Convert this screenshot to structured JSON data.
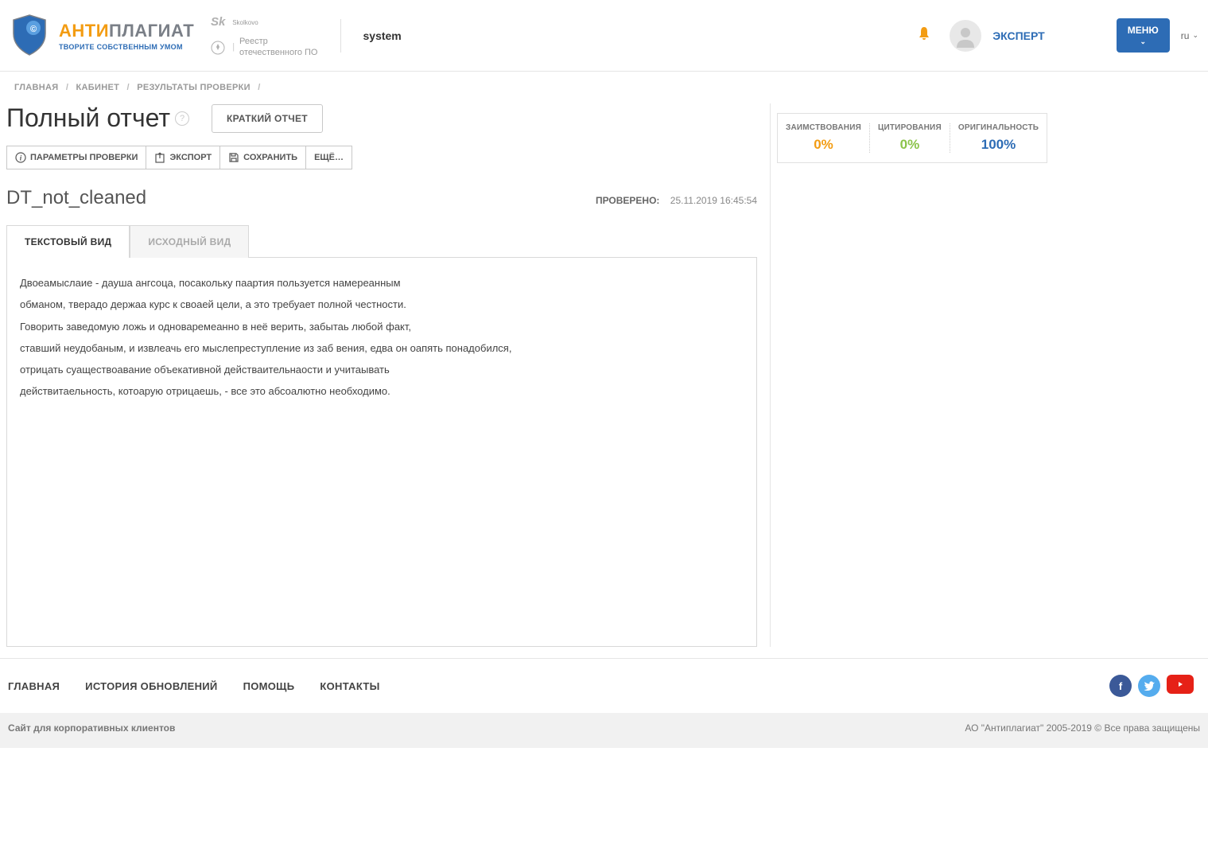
{
  "header": {
    "logo_prefix": "АНТИ",
    "logo_suffix": "ПЛАГИАТ",
    "logo_subtitle": "ТВОРИТЕ СОБСТВЕННЫМ УМОМ",
    "partner_sk": "Skolkovo",
    "partner_registry_l1": "Реестр",
    "partner_registry_l2": "отечественного ПО",
    "system_label": "system",
    "role_label": "ЭКСПЕРТ",
    "menu_label": "МЕНЮ",
    "lang": "ru"
  },
  "breadcrumb": {
    "items": [
      "ГЛАВНАЯ",
      "КАБИНЕТ",
      "РЕЗУЛЬТАТЫ ПРОВЕРКИ"
    ]
  },
  "title": {
    "main": "Полный отчет",
    "short_report_btn": "КРАТКИЙ ОТЧЕТ"
  },
  "toolbar": {
    "params": "ПАРАМЕТРЫ ПРОВЕРКИ",
    "export": "ЭКСПОРТ",
    "save": "СОХРАНИТЬ",
    "more": "ЕЩЁ…"
  },
  "document": {
    "name": "DT_not_cleaned",
    "checked_label": "ПРОВЕРЕНО:",
    "checked_at": "25.11.2019 16:45:54"
  },
  "tabs": {
    "text_view": "ТЕКСТОВЫЙ ВИД",
    "source_view": "ИСХОДНЫЙ ВИД"
  },
  "content_lines": [
    "Двоеамыслаие - дауша ангсоца, посакольку паартия пользуется намереанным",
    "обманом, тверадо держаа курс к своаей цели, а это требуает полной честности.",
    "Говорить заведомую ложь и одноваремеанно в неё верить, забытаь любой факт,",
    "ставший неудобаным, и извлеачь его мыслепреступление из заб вения, едва он оапять понадобился,",
    "отрицать суаществоавание объекативной действаительнаости и учитаывать",
    "действитаельность, котоарую отрицаешь, - все это абсоалютно необходимо."
  ],
  "stats": {
    "borrow_label": "ЗАИМСТВОВАНИЯ",
    "borrow_value": "0%",
    "cite_label": "ЦИТИРОВАНИЯ",
    "cite_value": "0%",
    "orig_label": "ОРИГИНАЛЬНОСТЬ",
    "orig_value": "100%"
  },
  "footer": {
    "nav": [
      "ГЛАВНАЯ",
      "ИСТОРИЯ ОБНОВЛЕНИЙ",
      "ПОМОЩЬ",
      "КОНТАКТЫ"
    ],
    "corp_link": "Сайт для корпоративных клиентов",
    "copyright": "АО \"Антиплагиат\" 2005-2019 © Все права защищены"
  }
}
